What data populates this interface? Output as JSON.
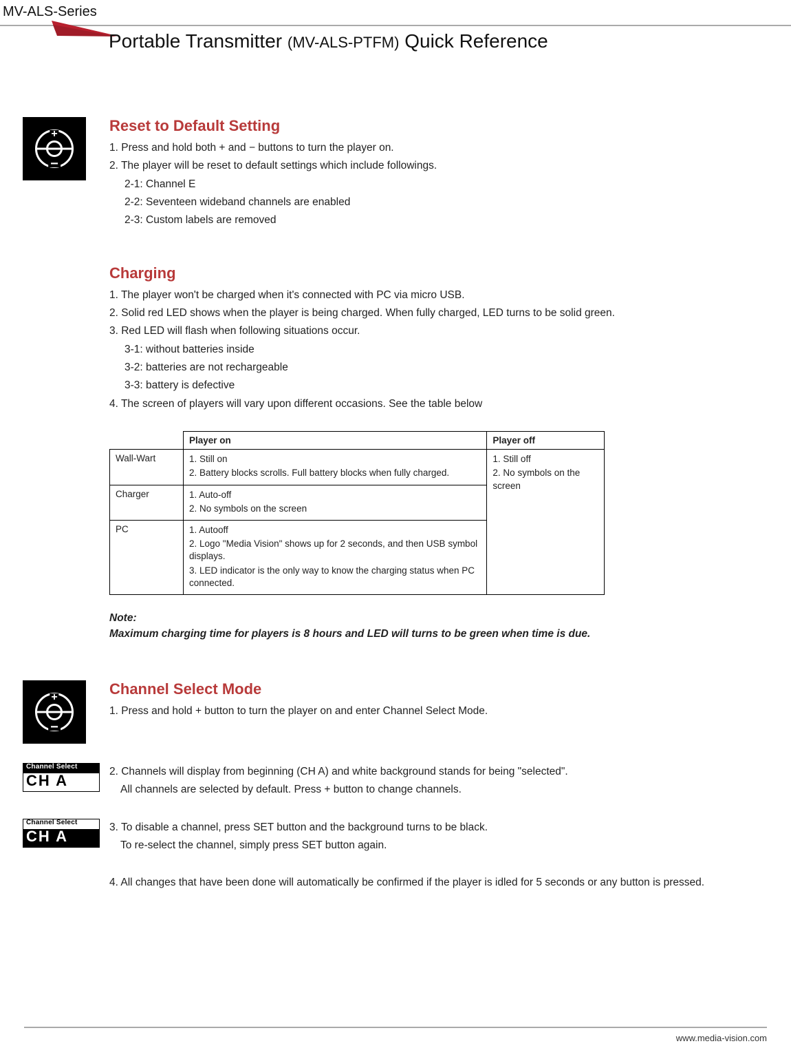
{
  "series": "MV-ALS-Series",
  "title_main": "Portable Transmitter ",
  "title_sub": "(MV-ALS-PTFM)",
  "title_tail": " Quick Reference",
  "sections": {
    "reset": {
      "heading": "Reset to Default Setting",
      "items": [
        "1. Press and hold both + and − buttons to turn the player on.",
        "2. The player will be reset to default settings which include followings."
      ],
      "subitems": [
        "2-1: Channel E",
        "2-2: Seventeen wideband channels are enabled",
        "2-3: Custom labels are removed"
      ]
    },
    "charging": {
      "heading": "Charging",
      "items": [
        "1. The player won't be charged when it's connected with PC via micro USB.",
        "2. Solid red LED shows when the player is being charged. When fully charged, LED turns to be solid green.",
        "3. Red LED will flash when following situations occur."
      ],
      "subitems": [
        "3-1: without batteries inside",
        "3-2: batteries are not rechargeable",
        "3-3: battery is defective"
      ],
      "item4": "4. The screen of players will vary upon different occasions. See the table below",
      "table": {
        "head_on": "Player on",
        "head_off": "Player off",
        "rows": [
          {
            "label": "Wall-Wart",
            "on": [
              "1. Still on",
              "2. Battery blocks scrolls. Full battery blocks when fully charged."
            ]
          },
          {
            "label": "Charger",
            "on": [
              "1. Auto-off",
              "2. No symbols on the screen"
            ]
          },
          {
            "label": "PC",
            "on": [
              "1. Autooff",
              "2. Logo \"Media Vision\" shows up for 2 seconds, and then USB symbol displays.",
              "3. LED indicator is the only way to know the charging status when PC connected."
            ]
          }
        ],
        "off": [
          "1. Still off",
          "2. No symbols on the screen"
        ]
      },
      "note_label": "Note:",
      "note_text": "Maximum charging time for players is 8 hours and LED will turns to be green when time is due."
    },
    "channel": {
      "heading": "Channel Select Mode",
      "step1": "1. Press and hold + button to turn the player on and enter Channel Select Mode.",
      "display_label": "Channel Select",
      "display_text": "CH A",
      "step2a": "2. Channels will display from beginning (CH A) and white background stands for being \"selected\".",
      "step2b": "All channels are selected by default. Press + button to change channels.",
      "step3a": "3. To disable a channel, press SET button and the background turns to be black.",
      "step3b": "To re-select the channel, simply press SET button again.",
      "step4": "4. All changes that have been done will automatically be confirmed if the player is idled for 5 seconds or any button is pressed."
    }
  },
  "footer": "www.media-vision.com"
}
